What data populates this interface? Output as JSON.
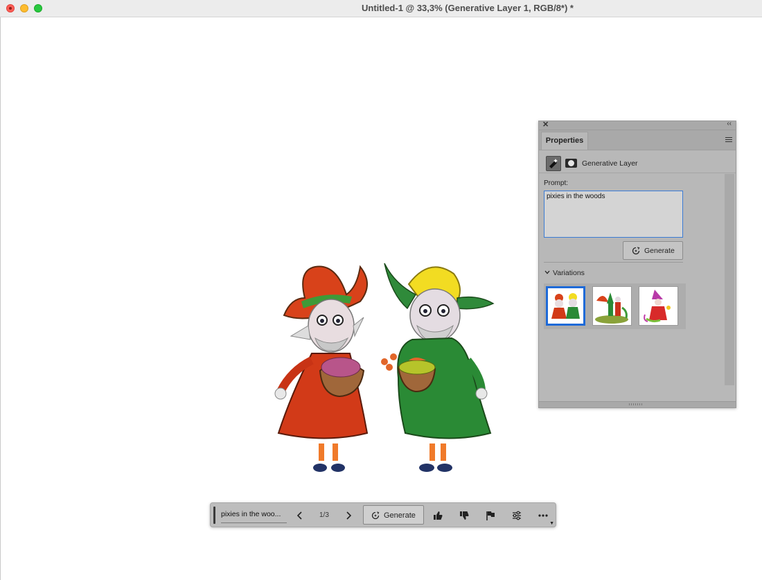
{
  "window": {
    "title": "Untitled-1 @ 33,3% (Generative Layer 1, RGB/8*) *"
  },
  "properties_panel": {
    "tab_label": "Properties",
    "layer_type_label": "Generative Layer",
    "prompt_label": "Prompt:",
    "prompt_value": "pixies in the woods",
    "generate_label": "Generate",
    "variations_label": "Variations",
    "selected_variation": 1
  },
  "taskbar": {
    "prompt_value": "pixies in the woo...",
    "counter": "1/3",
    "generate_label": "Generate"
  },
  "colors": {
    "selection_accent": "#1e6ad8",
    "panel_bg": "#b8b8b8"
  },
  "icons": [
    "close-icon",
    "collapse-icon",
    "panel-menu-icon",
    "generative-layer-icon",
    "mask-icon",
    "regenerate-icon",
    "chevron-down-icon",
    "chevron-left-icon",
    "chevron-right-icon",
    "thumbs-up-icon",
    "thumbs-down-icon",
    "flag-icon",
    "settings-sliders-icon",
    "more-icon"
  ]
}
